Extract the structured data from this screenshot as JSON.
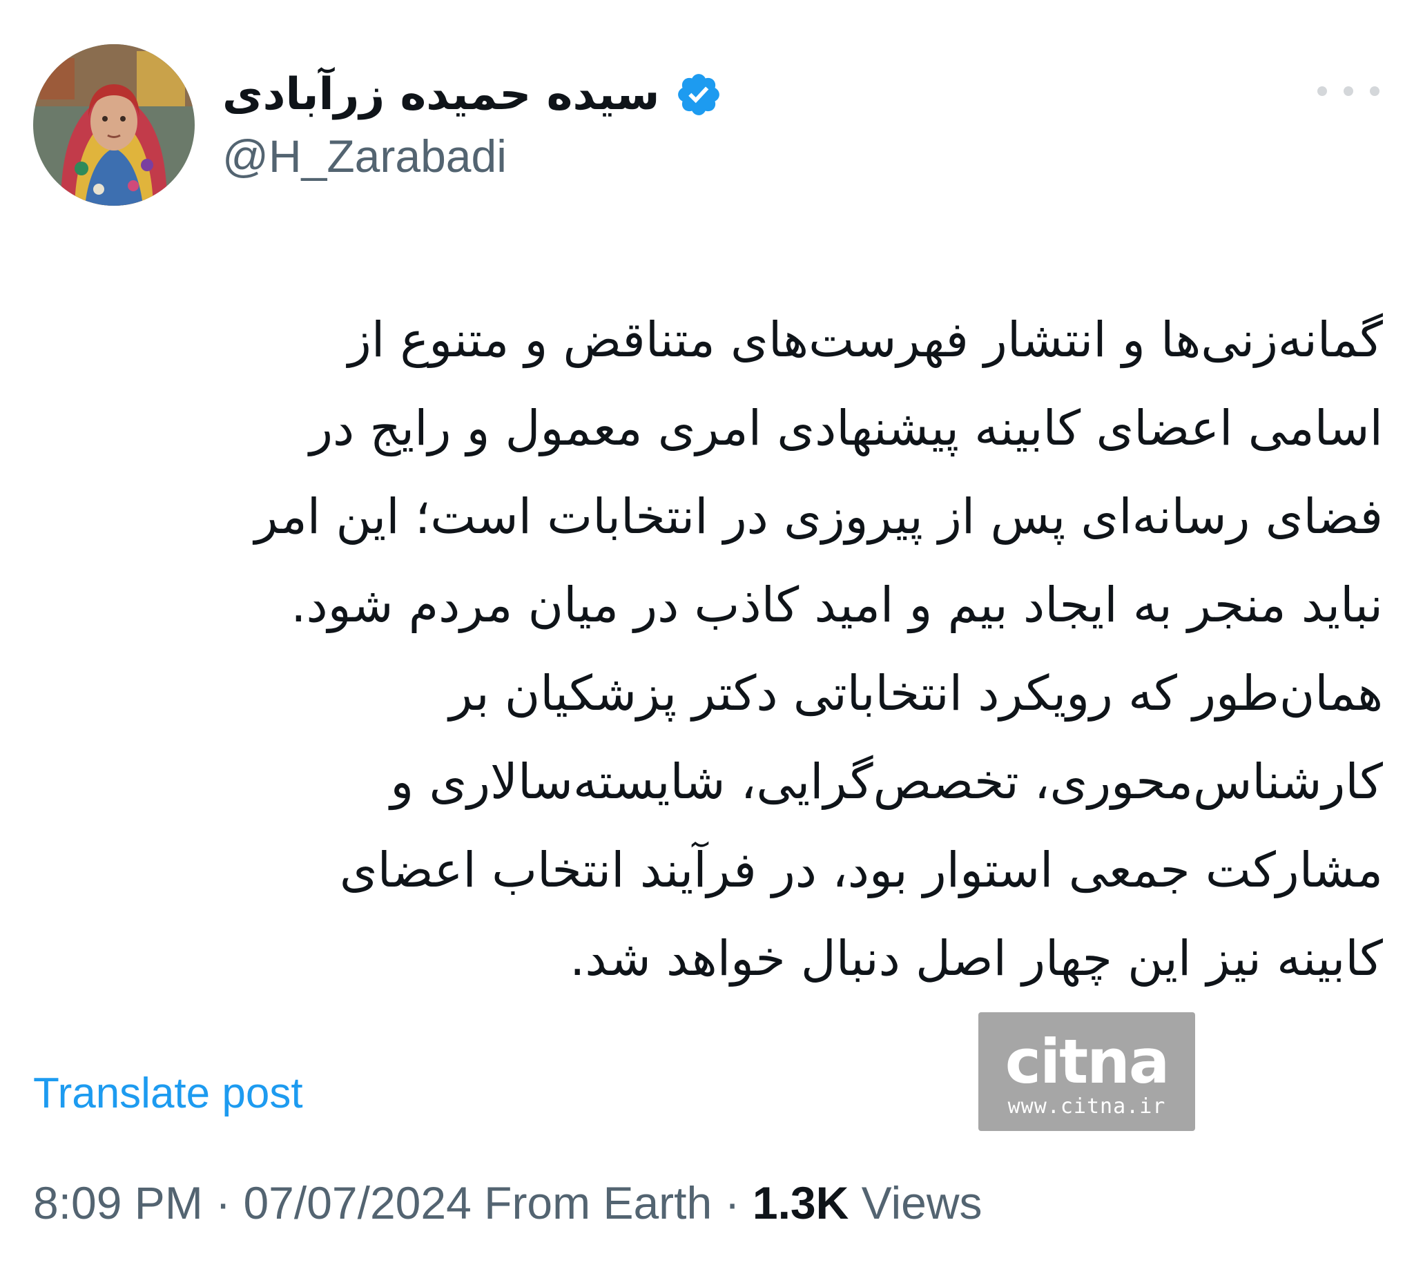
{
  "author": {
    "display_name": "سیده حمیده زرآبادی",
    "handle": "@H_Zarabadi",
    "verified": true,
    "verified_icon": "verified-badge-icon",
    "badge_color": "#1d9bf0"
  },
  "more_icon": "more-horizontal-icon",
  "tweet": {
    "lines": [
      "گمانه‌زنی‌ها و انتشار فهرست‌های متناقض و متنوع از",
      "اسامی اعضای کابینه پیشنهادی امری معمول و رایج در",
      "فضای رسانه‌ای پس از پیروزی در انتخابات است؛ این امر",
      "نباید منجر به ایجاد بیم و امید کاذب در میان مردم شود.",
      "همان‌طور که رویکرد انتخاباتی دکتر پزشکیان بر",
      "کارشناس‌محوری، تخصص‌گرایی، شایسته‌سالاری و",
      "مشارکت جمعی استوار بود، در فرآیند انتخاب اعضای",
      "کابینه نیز این چهار اصل دنبال خواهد شد."
    ]
  },
  "watermark": {
    "logo": "citna",
    "url": "www.citna.ir"
  },
  "translate_label": "Translate post",
  "meta": {
    "time": "8:09 PM",
    "separator": "·",
    "date": "07/07/2024",
    "source": "From Earth",
    "views_count": "1.3K",
    "views_label": "Views"
  },
  "colors": {
    "text": "#0f1419",
    "secondary": "#536471",
    "link": "#1d9bf0",
    "watermark_bg": "#a6a6a6"
  }
}
